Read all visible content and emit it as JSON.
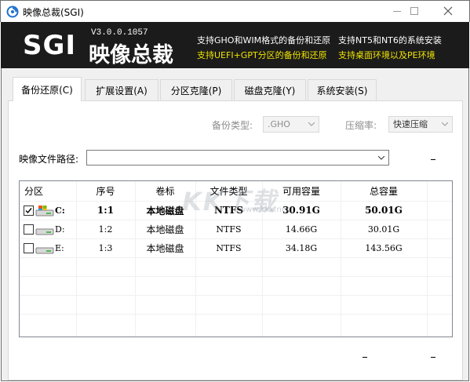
{
  "window": {
    "title": "映像总裁(SGI)"
  },
  "banner": {
    "logo": "SGI",
    "logo_cn": "映像总裁",
    "version": "V3.0.0.1057",
    "features": [
      "支持GHO和WIM格式的备份和还原",
      "支持NT5和NT6的系统安装",
      "支持UEFI+GPT分区的备份和还原",
      "支持桌面环境以及PE环境"
    ]
  },
  "tabs": [
    {
      "label": "备份还原(C)",
      "active": true
    },
    {
      "label": "扩展设置(A)",
      "active": false
    },
    {
      "label": "分区克隆(P)",
      "active": false
    },
    {
      "label": "磁盘克隆(Y)",
      "active": false
    },
    {
      "label": "系统安装(S)",
      "active": false
    }
  ],
  "options": {
    "backup_type_label": "备份类型:",
    "backup_type_value": ".GHO",
    "compression_label": "压缩率:",
    "compression_value": "快速压缩"
  },
  "image_path": {
    "label": "映像文件路径:",
    "value": ""
  },
  "partition_table": {
    "headers": [
      "分区",
      "序号",
      "卷标",
      "文件类型",
      "可用容量",
      "总容量"
    ],
    "rows": [
      {
        "checked": true,
        "drive": "C:",
        "index": "1:1",
        "label": "本地磁盘",
        "fs": "NTFS",
        "free": "30.91G",
        "total": "50.01G",
        "bold": true
      },
      {
        "checked": false,
        "drive": "D:",
        "index": "1:2",
        "label": "本地磁盘",
        "fs": "NTFS",
        "free": "14.66G",
        "total": "30.01G",
        "bold": false
      },
      {
        "checked": false,
        "drive": "E:",
        "index": "1:3",
        "label": "本地磁盘",
        "fs": "NTFS",
        "free": "34.18G",
        "total": "143.56G",
        "bold": false
      }
    ]
  },
  "watermark": {
    "text": "KK下载",
    "sub": "www.kkx.net"
  },
  "status_marks": [
    "-",
    "-",
    "-"
  ]
}
